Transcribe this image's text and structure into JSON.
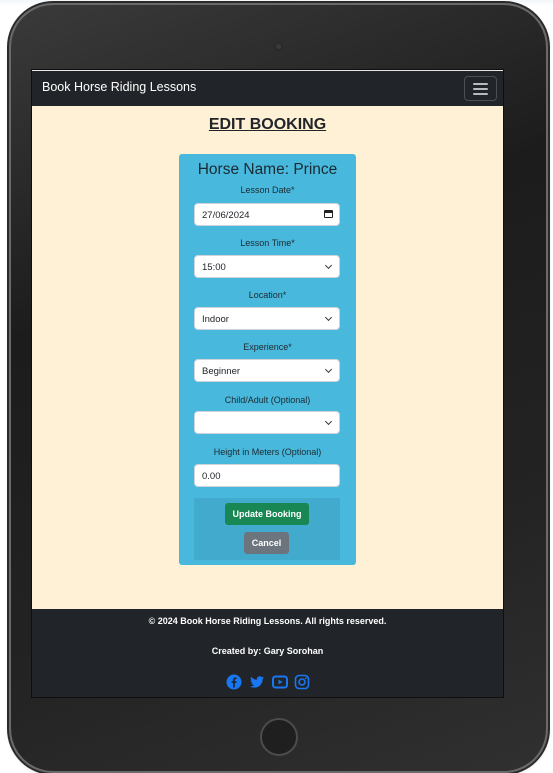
{
  "navbar": {
    "brand": "Book Horse Riding Lessons"
  },
  "page": {
    "title": "EDIT BOOKING"
  },
  "form": {
    "horse_name": "Horse Name: Prince",
    "fields": [
      {
        "label": "Lesson Date*",
        "value": "27/06/2024",
        "type": "date"
      },
      {
        "label": "Lesson Time*",
        "value": "15:00",
        "type": "select"
      },
      {
        "label": "Location*",
        "value": "Indoor",
        "type": "select"
      },
      {
        "label": "Experience*",
        "value": "Beginner",
        "type": "select"
      },
      {
        "label": "Child/Adult (Optional)",
        "value": "",
        "type": "select"
      },
      {
        "label": "Height in Meters (Optional)",
        "value": "0.00",
        "type": "number"
      }
    ],
    "update_label": "Update Booking",
    "cancel_label": "Cancel"
  },
  "footer": {
    "copyright": "© 2024 Book Horse Riding Lessons. All rights reserved.",
    "credit": "Created by: Gary Sorohan",
    "social_icons": [
      "facebook-icon",
      "twitter-icon",
      "youtube-icon",
      "instagram-icon"
    ]
  },
  "colors": {
    "navbar": "#212529",
    "page_background": "#fff1d6",
    "card": "#48b8dc",
    "update_button": "#198754",
    "cancel_button": "#6c757d",
    "social_icon": "#1877f2"
  }
}
